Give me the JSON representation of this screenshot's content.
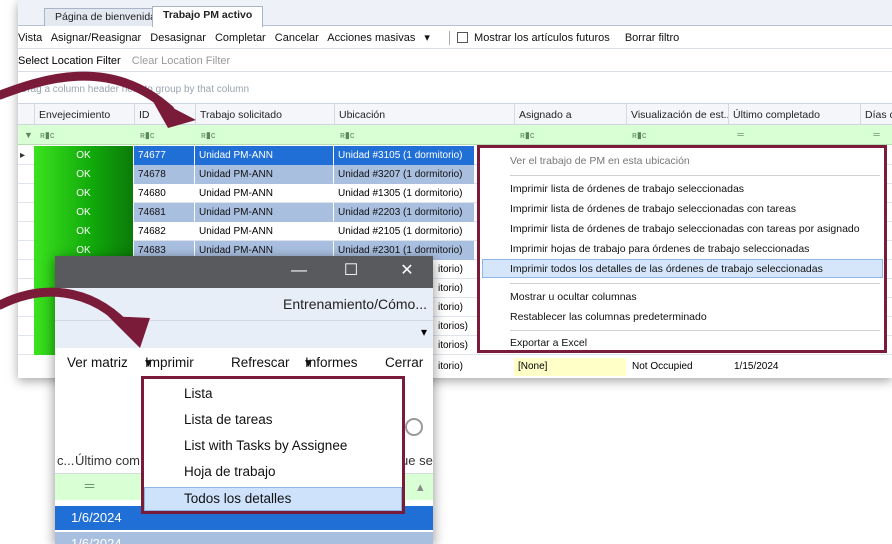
{
  "tabs": [
    "Página de bienvenida",
    "Trabajo PM activo"
  ],
  "toolbar": {
    "vista": "Vista",
    "asignar": "Asignar/Reasignar",
    "desasignar": "Desasignar",
    "completar": "Completar",
    "cancelar": "Cancelar",
    "acciones": "Acciones masivas",
    "mostrar_futuros": "Mostrar los artículos futuros",
    "borrar_filtro": "Borrar filtro"
  },
  "location_filter": {
    "select": "Select Location Filter",
    "clear": "Clear Location Filter"
  },
  "group_hint": "Drag a column header here to group by that column",
  "columns": [
    "Envejecimiento",
    "ID",
    "Trabajo solicitado",
    "Ubicación",
    "Asignado a",
    "Visualización de est...",
    "Último completado",
    "Días c"
  ],
  "rows": [
    {
      "env": "OK",
      "id": "74677",
      "trabajo": "Unidad PM-ANN",
      "ubicacion": "Unidad #3105 (1 dormitorio)"
    },
    {
      "env": "OK",
      "id": "74678",
      "trabajo": "Unidad PM-ANN",
      "ubicacion": "Unidad #3207 (1 dormitorio)"
    },
    {
      "env": "OK",
      "id": "74680",
      "trabajo": "Unidad PM-ANN",
      "ubicacion": "Unidad #1305 (1 dormitorio)"
    },
    {
      "env": "OK",
      "id": "74681",
      "trabajo": "Unidad PM-ANN",
      "ubicacion": "Unidad #2203 (1 dormitorio)"
    },
    {
      "env": "OK",
      "id": "74682",
      "trabajo": "Unidad PM-ANN",
      "ubicacion": "Unidad #2105 (1 dormitorio)"
    },
    {
      "env": "OK",
      "id": "74683",
      "trabajo": "Unidad PM-ANN",
      "ubicacion": "Unidad #2301 (1 dormitorio)"
    }
  ],
  "partial_rows": [
    "itorio)",
    "itorio)",
    "itorio)",
    "itorios)",
    "itorios)"
  ],
  "last_row": {
    "ubicacion_tail": "itorio)",
    "asignado": "[None]",
    "estado": "Not Occupied",
    "completado": "1/15/2024"
  },
  "context_menu": {
    "items": [
      "Ver el trabajo de PM en esta ubicación",
      "Imprimir lista de órdenes de trabajo seleccionadas",
      "Imprimir lista de órdenes de trabajo seleccionadas con tareas",
      "Imprimir lista de órdenes de trabajo seleccionadas con tareas por asignado",
      "Imprimir hojas de trabajo para órdenes de trabajo seleccionadas",
      "Imprimir todos los detalles de las órdenes de trabajo seleccionadas",
      "Mostrar u ocultar columnas",
      "Restablecer las columnas predeterminado",
      "Exportar a Excel"
    ]
  },
  "window": {
    "minimize": "—",
    "maximize": "☐",
    "close": "✕",
    "training": "Entrenamiento/Cómo...",
    "menu": [
      "Ver matriz",
      "Imprimir",
      "Refrescar",
      "Informes",
      "Cerrar"
    ],
    "print_items": [
      "Lista",
      "Lista de tareas",
      "List with Tasks by Assignee",
      "Hoja de trabajo",
      "Todos los detalles"
    ],
    "grid_header_left": "c...",
    "grid_header_mid": "Último com",
    "grid_header_right": "ue se",
    "grid_rows": [
      "1/6/2024",
      "1/6/2024"
    ]
  },
  "colors": {
    "accent_border": "#7b1b3a",
    "selection": "#1f6fd6",
    "filter_row": "#d9ffd4"
  }
}
